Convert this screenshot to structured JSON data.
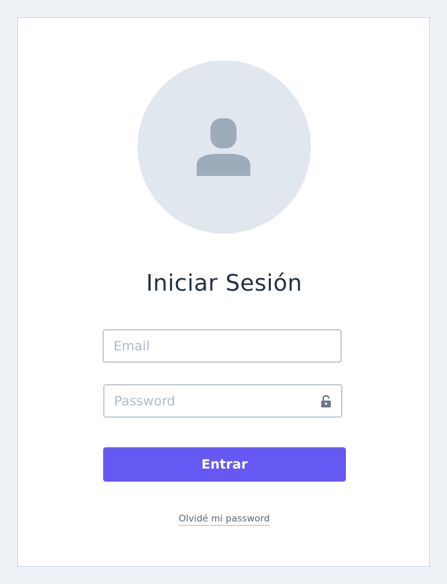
{
  "login": {
    "title": "Iniciar Sesión",
    "email": {
      "placeholder": "Email",
      "value": ""
    },
    "password": {
      "placeholder": "Password",
      "value": ""
    },
    "submit_label": "Entrar",
    "forgot_label": "Olvidé mi password"
  },
  "icons": {
    "avatar": "user-icon",
    "password_toggle": "unlock-icon"
  },
  "colors": {
    "page_background": "#eef2f6",
    "card_border": "#c9d3df",
    "avatar_background": "#e1e7ef",
    "avatar_icon": "#9dacbb",
    "title_text": "#22303f",
    "input_border": "#c3ccd7",
    "placeholder": "#adbac8",
    "primary_button": "#6658f3",
    "link_text": "#5a6878"
  }
}
